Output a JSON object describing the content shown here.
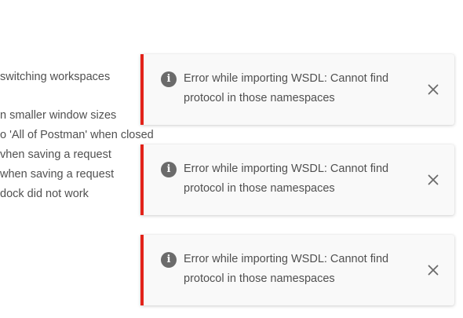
{
  "background": {
    "lines": [
      "switching workspaces",
      "n smaller window sizes",
      "o 'All of Postman' when closed",
      "vhen saving a request",
      " when saving a request",
      "dock did not work"
    ]
  },
  "toasts": [
    {
      "message": "Error while importing WSDL: Cannot find protocol in those namespaces",
      "icon": "info-icon",
      "close_icon": "close-icon"
    },
    {
      "message": "Error while importing WSDL: Cannot find protocol in those namespaces",
      "icon": "info-icon",
      "close_icon": "close-icon"
    },
    {
      "message": "Error while importing WSDL: Cannot find protocol in those namespaces",
      "icon": "info-icon",
      "close_icon": "close-icon"
    }
  ],
  "colors": {
    "error_accent": "#e2231a",
    "toast_background": "#f9f9f9",
    "text": "#505050",
    "icon": "#6b6b6b"
  }
}
